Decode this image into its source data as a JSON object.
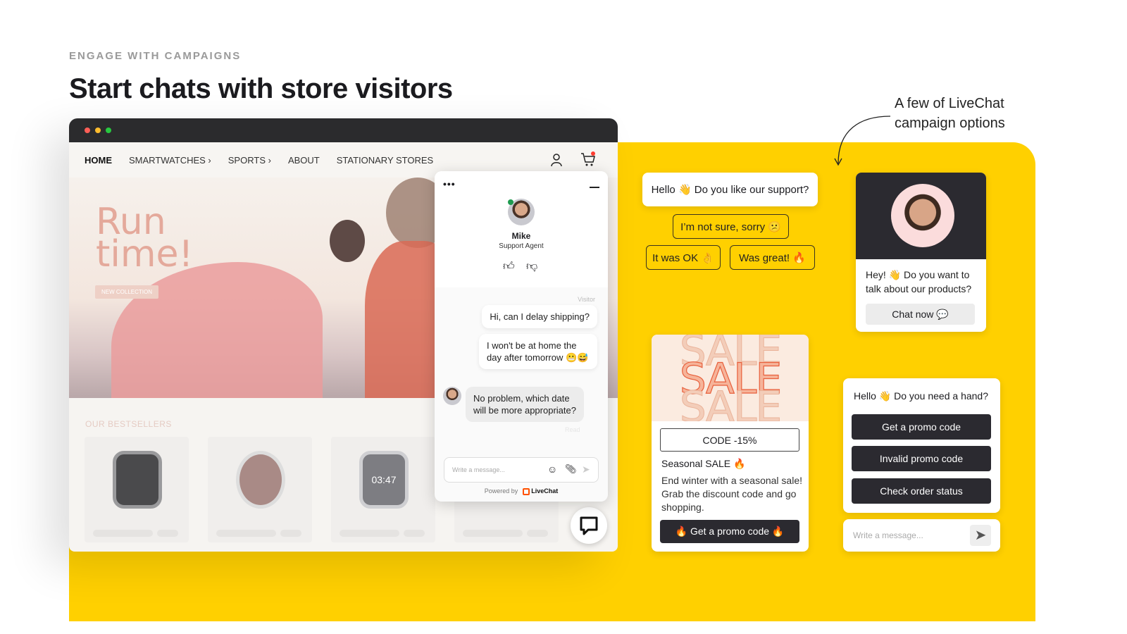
{
  "header": {
    "eyebrow": "ENGAGE WITH CAMPAIGNS",
    "title": "Start chats with store visitors"
  },
  "annotation": {
    "line1": "A few of LiveChat",
    "line2": "campaign options"
  },
  "colors": {
    "brand_yellow": "#ffd000",
    "dark": "#2b2a30",
    "online": "#1e9b4f",
    "livechat_orange": "#ff5100"
  },
  "store": {
    "nav": [
      {
        "label": "HOME"
      },
      {
        "label": "SMARTWATCHES ›"
      },
      {
        "label": "SPORTS ›"
      },
      {
        "label": "ABOUT"
      },
      {
        "label": "STATIONARY STORES"
      }
    ],
    "hero_line1": "Run",
    "hero_line2": "time!",
    "hero_button": "NEW COLLECTION",
    "bestsellers": "OUR BESTSELLERS",
    "watch_time": "03:47"
  },
  "widget": {
    "agent_name": "Mike",
    "agent_role": "Support Agent",
    "visitor_label": "Visitor",
    "messages": [
      "Hi, can I delay shipping?",
      "I won't be at home the day after tomorrow 😬😅",
      "No problem, which date will be more appropriate?"
    ],
    "read_label": "Read",
    "input_placeholder": "Write a message...",
    "powered_by": "Powered by",
    "brand": "LiveChat"
  },
  "campaigns": {
    "survey": {
      "question": "Hello 👋 Do you like our support?",
      "options": [
        "I’m not sure, sorry 😕",
        "It was OK 👌",
        "Was great! 🔥"
      ]
    },
    "agent_card": {
      "text": "Hey! 👋 Do you want to talk about our products?",
      "button": "Chat now 💬"
    },
    "sale": {
      "word": "SALE",
      "code": "CODE -15%",
      "title": "Seasonal SALE 🔥",
      "body": "End winter with a seasonal sale! Grab the discount code and go shopping.",
      "button": "🔥 Get a promo code 🔥"
    },
    "help": {
      "question": "Hello 👋 Do you need a hand?",
      "buttons": [
        "Get a promo code",
        "Invalid promo code",
        "Check order status"
      ],
      "input_placeholder": "Write a message..."
    }
  }
}
